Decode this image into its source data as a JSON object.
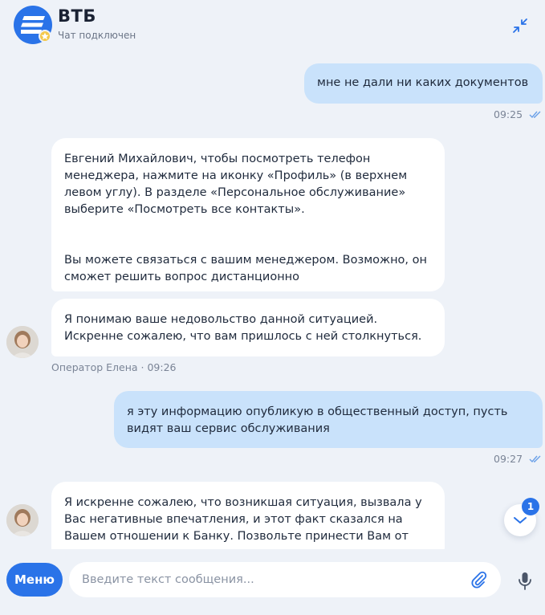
{
  "header": {
    "title": "ВТБ",
    "status": "Чат подключен"
  },
  "messages": [
    {
      "id": "m1",
      "direction": "out",
      "text": "мне не дали ни каких документов",
      "time": "09:25"
    },
    {
      "id": "m2",
      "direction": "in",
      "paragraphs": [
        "Евгений Михайлович, чтобы посмотреть телефон менеджера, нажмите на иконку «Профиль» (в верхнем левом углу). В разделе «Персональное обслуживание» выберите «Посмотреть все контакты».",
        "Вы можете связаться с вашим менеджером. Возможно, он сможет решить вопрос дистанционно"
      ]
    },
    {
      "id": "m3",
      "direction": "in",
      "text": "Я понимаю ваше недовольство данной ситуацией. Искренне сожалею, что вам пришлось с ней столкнуться.",
      "operator": "Оператор Елена · 09:26"
    },
    {
      "id": "m4",
      "direction": "out",
      "text": "я эту информацию опубликую в общественный доступ, пусть видят ваш сервис обслуживания",
      "time": "09:27"
    },
    {
      "id": "m5",
      "direction": "in",
      "text": "Я искренне сожалею, что возникшая ситуация, вызвала у Вас негативные впечатления, и этот факт сказался на Вашем отношении к Банку. Позвольте принести Вам от"
    }
  ],
  "scroll": {
    "unread_count": "1"
  },
  "bottom": {
    "menu_label": "Меню",
    "input_placeholder": "Введите текст сообщения...",
    "input_value": ""
  },
  "colors": {
    "accent": "#2a73e8",
    "outgoing_bubble": "#c9e2fb",
    "incoming_bubble": "#ffffff",
    "background": "#eef2f8"
  },
  "icons": {
    "logo": "vtb-logo-icon",
    "badge": "star-badge-icon",
    "collapse": "collapse-arrows-icon",
    "read_status": "double-check-icon",
    "scroll_down": "chevron-down-icon",
    "attach": "paperclip-icon",
    "mic": "microphone-icon"
  }
}
